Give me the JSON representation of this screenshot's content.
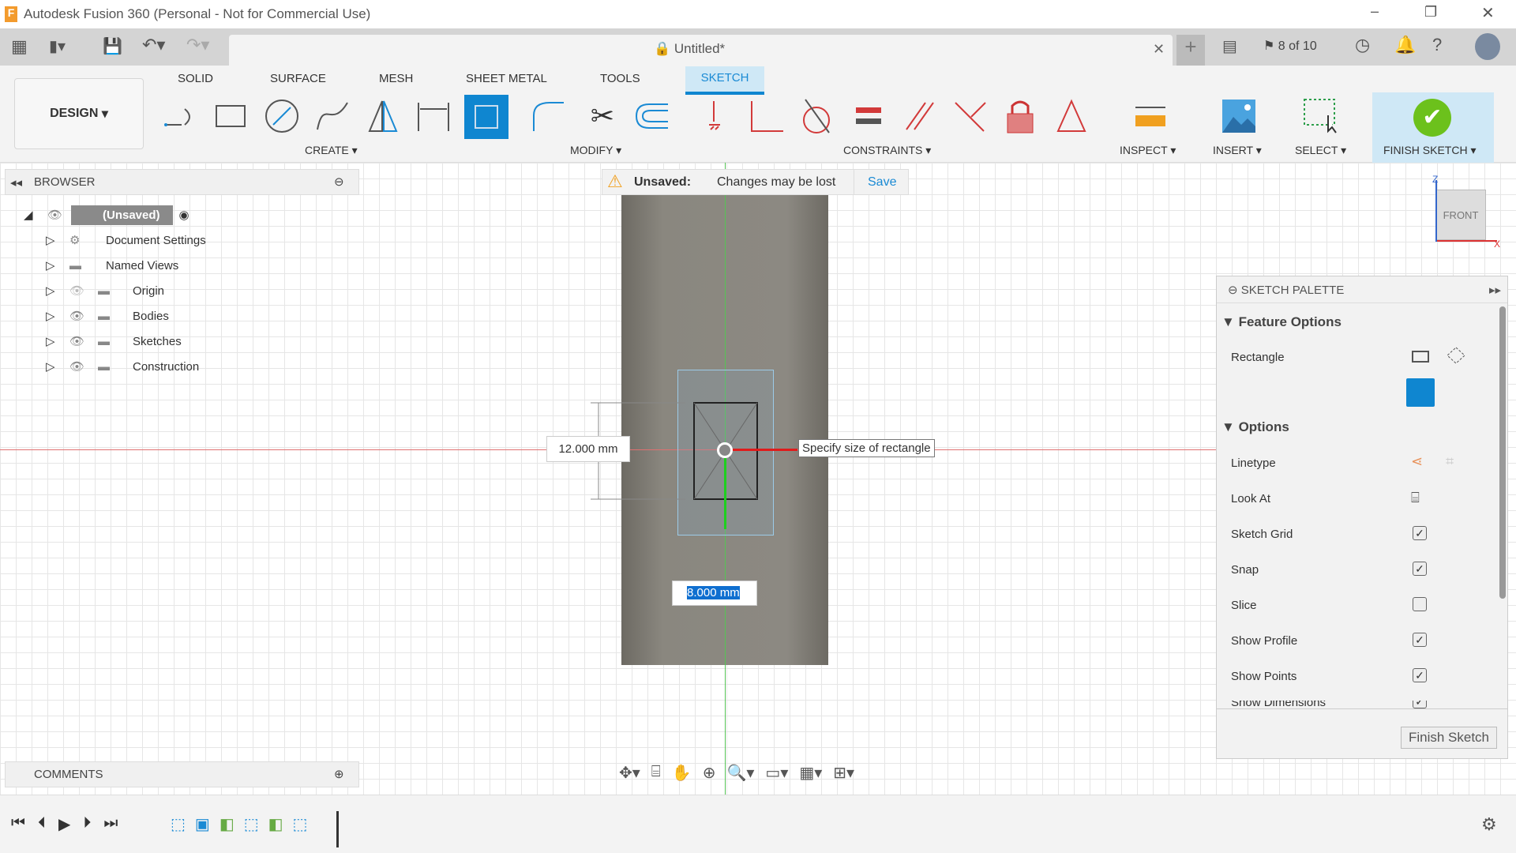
{
  "window": {
    "title": "Autodesk Fusion 360 (Personal - Not for Commercial Use)"
  },
  "tabbar": {
    "doc_title": "Untitled*",
    "jobs": "8 of 10"
  },
  "ribbon": {
    "workspace": "DESIGN",
    "tabs": [
      "SOLID",
      "SURFACE",
      "MESH",
      "SHEET METAL",
      "TOOLS",
      "SKETCH"
    ],
    "groups": [
      "CREATE",
      "MODIFY",
      "CONSTRAINTS",
      "INSPECT",
      "INSERT",
      "SELECT",
      "FINISH SKETCH"
    ]
  },
  "browser": {
    "title": "BROWSER",
    "root": "(Unsaved)",
    "items": [
      "Document Settings",
      "Named Views",
      "Origin",
      "Bodies",
      "Sketches",
      "Construction"
    ]
  },
  "unsaved": {
    "label": "Unsaved:",
    "message": "Changes may be lost",
    "save": "Save"
  },
  "sketch": {
    "dim_height": "12.000 mm",
    "dim_width": "8.000 mm",
    "tooltip": "Specify size of rectangle"
  },
  "viewcube": {
    "face": "FRONT",
    "z": "Z",
    "x": "X"
  },
  "palette": {
    "title": "SKETCH PALETTE",
    "feature_options": "Feature Options",
    "rectangle": "Rectangle",
    "options": "Options",
    "rows": [
      {
        "label": "Linetype"
      },
      {
        "label": "Look At"
      },
      {
        "label": "Sketch Grid",
        "checked": true
      },
      {
        "label": "Snap",
        "checked": true
      },
      {
        "label": "Slice",
        "checked": false
      },
      {
        "label": "Show Profile",
        "checked": true
      },
      {
        "label": "Show Points",
        "checked": true
      },
      {
        "label": "Show Dimensions",
        "checked": true
      }
    ],
    "finish": "Finish Sketch"
  },
  "comments": {
    "title": "COMMENTS"
  },
  "colors": {
    "accent": "#0f86d0",
    "finish": "#6cc11c",
    "constraint": "#d23a3a"
  }
}
